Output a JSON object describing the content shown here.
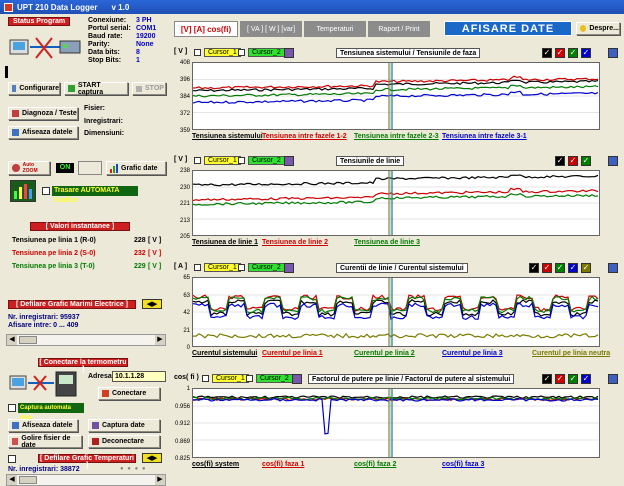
{
  "window": {
    "title": "UPT 210 Data Logger",
    "version": "v 1.0"
  },
  "left": {
    "status_header": "Status Program",
    "conn": [
      {
        "label": "Conexiune:",
        "value": "3 PH"
      },
      {
        "label": "Portul serial:",
        "value": "COM1"
      },
      {
        "label": "Baud rate:",
        "value": "19200"
      },
      {
        "label": "Parity:",
        "value": "None"
      },
      {
        "label": "Data bits:",
        "value": "8"
      },
      {
        "label": "Stop Bits:",
        "value": "1"
      }
    ],
    "configure": "Configurare",
    "start_capture": "START captura",
    "stop": "STOP",
    "diagnose": "Diagnoza / Teste",
    "show_data": "Afiseaza datele",
    "file_labels": [
      "Fisier:",
      "Inregistrari:",
      "Dimensiuni:"
    ],
    "auto_zoom": "Auto ZOOM",
    "on": "ON",
    "chart_data_btn": "Grafic date",
    "auto_trace": "Trasare AUTOMATA Grafice",
    "instant_header": "[ Valori   instantanee ]",
    "instant": [
      {
        "label": "Tensiunea pe linia 1 (R-0)",
        "value": "228",
        "unit": "[ V ]",
        "color": "#000000"
      },
      {
        "label": "Tensiunea pe linia 2 (S-0)",
        "value": "232",
        "unit": "[ V ]",
        "color": "#cc0000"
      },
      {
        "label": "Tensiunea pe linia 3 (T-0)",
        "value": "229",
        "unit": "[ V ]",
        "color": "#007a00"
      }
    ],
    "scroll_header": "[ Defilare Grafic Marimi Electrice ]",
    "nr_reg": "Nr. inregistrari: 95937",
    "afisare": "Afisare intre:  0 ... 409",
    "thermo_header": "[ Conectare la termometru ]",
    "address_label": "Adresa:",
    "address_value": "10.1.1.28",
    "connect": "Conectare",
    "auto_capture": "Captura automata date",
    "show_data2": "Afiseaza datele",
    "capture_data": "Captura date",
    "clear_file": "Golire fisier de date",
    "disconnect": "Deconectare",
    "temp_scroll_header": "[ Defilare Grafic Temperaturi ]",
    "nr_reg2": "Nr. inregistrari: 38872"
  },
  "tabs": [
    {
      "label": "[V]  [A]  cos(fi)"
    },
    {
      "label": "[ VA ]  [ W ]  [var]"
    },
    {
      "label": "Temperaturi"
    },
    {
      "label": "Raport / Print"
    }
  ],
  "banner": "AFISARE  DATE",
  "about": "Despre...",
  "cursor1": "Cursor_1",
  "cursor2": "Cursor_2",
  "charts": [
    {
      "unit": "[ V ]",
      "title": "Tensiunea sistemului / Tensiunile de faza",
      "ticks": [
        "408",
        "396",
        "384",
        "372",
        "359"
      ],
      "legend": [
        {
          "t": "Tensiunea sistemului",
          "c": "#000000"
        },
        {
          "t": "Tensiunea intre fazele 1-2",
          "c": "#cc0000"
        },
        {
          "t": "Tensiunea intre fazele 2-3",
          "c": "#007a00"
        },
        {
          "t": "Tensiunea intre fazele 3-1",
          "c": "#0000cc"
        }
      ]
    },
    {
      "unit": "[ V ]",
      "title": "Tensiunile de linie",
      "ticks": [
        "238",
        "230",
        "221",
        "213",
        "205"
      ],
      "legend": [
        {
          "t": "Tensiunea de linie 1",
          "c": "#000000"
        },
        {
          "t": "Tensiunea de linie 2",
          "c": "#cc0000"
        },
        {
          "t": "Tensiunea de linie 3",
          "c": "#007a00"
        }
      ]
    },
    {
      "unit": "[ A ]",
      "title": "Curentii de linie / Curentul sistemului",
      "ticks": [
        "65",
        "63",
        "42",
        "21",
        "0"
      ],
      "legend": [
        {
          "t": "Curentul sistemului",
          "c": "#000000"
        },
        {
          "t": "Curentul pe linia 1",
          "c": "#cc0000"
        },
        {
          "t": "Curentul pe linia 2",
          "c": "#007a00"
        },
        {
          "t": "Curentul pe linia 3",
          "c": "#0000cc"
        },
        {
          "t": "Curentul pe linia neutra",
          "c": "#7a7a00"
        }
      ]
    },
    {
      "unit": "cos( fi )",
      "title": "Factorul de putere pe linie / Factorul de putere al sistemului",
      "ticks": [
        "1",
        "0.956",
        "0.912",
        "0.869",
        "0.825"
      ],
      "legend": [
        {
          "t": "cos(fi) system",
          "c": "#000000"
        },
        {
          "t": "cos(fi) faza 1",
          "c": "#cc0000"
        },
        {
          "t": "cos(fi) faza 2",
          "c": "#007a00"
        },
        {
          "t": "cos(fi) faza 3",
          "c": "#0000cc"
        }
      ]
    }
  ]
}
